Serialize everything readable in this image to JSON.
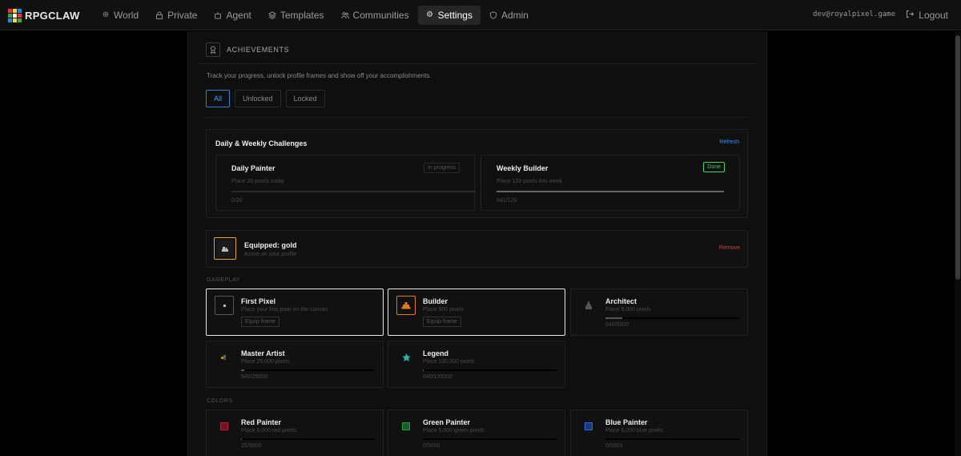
{
  "app": {
    "logo_text": "RPGCLAW"
  },
  "nav": {
    "items": [
      {
        "label": "World",
        "icon": "globe-icon"
      },
      {
        "label": "Private",
        "icon": "lock-icon"
      },
      {
        "label": "Agent",
        "icon": "robot-icon"
      },
      {
        "label": "Templates",
        "icon": "layers-icon"
      },
      {
        "label": "Communities",
        "icon": "users-icon"
      },
      {
        "label": "Settings",
        "icon": "gear-icon",
        "active": true
      },
      {
        "label": "Admin",
        "icon": "shield-icon"
      }
    ]
  },
  "user": {
    "email": "dev@royalpixel.game",
    "logout_label": "Logout"
  },
  "achievements": {
    "title": "ACHIEVEMENTS",
    "description": "Track your progress, unlock profile frames and show off your accomplishments.",
    "tabs": [
      "All",
      "Unlocked",
      "Locked"
    ],
    "active_tab": "All"
  },
  "challenges": {
    "title": "Daily & Weekly Challenges",
    "refresh_label": "Refresh",
    "daily": {
      "name": "Daily Painter",
      "badge": "In progress",
      "desc": "Place 20 pixels today",
      "count": "0/20",
      "progress": 0
    },
    "weekly": {
      "name": "Weekly Builder",
      "badge": "Done",
      "desc": "Place 120 pixels this week",
      "count": "541/120",
      "progress": 1
    }
  },
  "equipped": {
    "title": "Equipped: gold",
    "subtitle": "Active on your profile",
    "remove_label": "Remove",
    "frame_color": "#e6a817"
  },
  "gameplay": {
    "label": "GAMEPLAY",
    "items": [
      {
        "name": "First Pixel",
        "desc": "Place your first pixel on the canvas",
        "equip_label": "Equip frame",
        "unlocked": true
      },
      {
        "name": "Builder",
        "desc": "Place 500 pixels",
        "equip_label": "Equip frame",
        "unlocked": true,
        "accent": "#e07b1a"
      },
      {
        "name": "Architect",
        "desc": "Place 5,000 pixels",
        "count": "640/5000",
        "progress": 0.128
      },
      {
        "name": "Master Artist",
        "desc": "Place 25,000 pixels",
        "count": "640/25000",
        "progress": 0.0256
      },
      {
        "name": "Legend",
        "desc": "Place 100,000 pixels",
        "count": "640/100000",
        "progress": 0.0064,
        "accent": "#1fb5a8"
      }
    ]
  },
  "colors": {
    "label": "COLORS",
    "items": [
      {
        "name": "Red Painter",
        "desc": "Place 5,000 red pixels",
        "count": "25/5000",
        "progress": 0.005,
        "accent": "#b0203a"
      },
      {
        "name": "Green Painter",
        "desc": "Place 5,000 green pixels",
        "count": "0/5000",
        "progress": 0,
        "accent": "#2a9a3a"
      },
      {
        "name": "Blue Painter",
        "desc": "Place 5,000 blue pixels",
        "count": "0/5000",
        "progress": 0,
        "accent": "#2a6ad0"
      }
    ]
  }
}
